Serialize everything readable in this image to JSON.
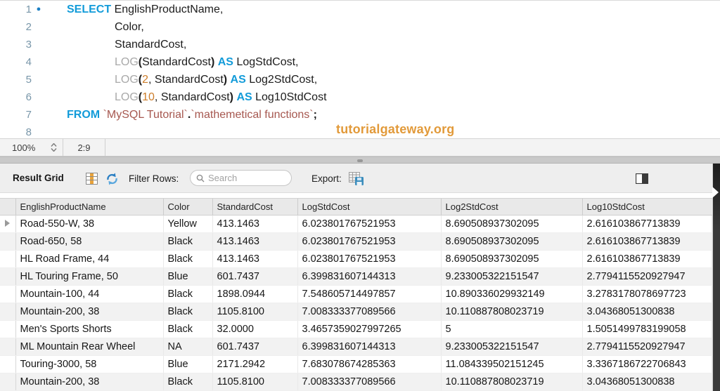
{
  "editor": {
    "watermark": "tutorialgateway.org",
    "lines": [
      {
        "num": "1",
        "marker": true,
        "indent": 0,
        "tokens": [
          {
            "t": "kw",
            "v": "SELECT"
          },
          {
            "t": "pl",
            "v": " EnglishProductName,"
          }
        ]
      },
      {
        "num": "2",
        "marker": false,
        "indent": 1,
        "tokens": [
          {
            "t": "pl",
            "v": "Color,"
          }
        ]
      },
      {
        "num": "3",
        "marker": false,
        "indent": 1,
        "tokens": [
          {
            "t": "pl",
            "v": "StandardCost,"
          }
        ]
      },
      {
        "num": "4",
        "marker": false,
        "indent": 1,
        "tokens": [
          {
            "t": "fn",
            "v": "LOG"
          },
          {
            "t": "pb",
            "v": "("
          },
          {
            "t": "pl",
            "v": "StandardCost"
          },
          {
            "t": "pb",
            "v": ")"
          },
          {
            "t": "pl",
            "v": " "
          },
          {
            "t": "kw",
            "v": "AS"
          },
          {
            "t": "pl",
            "v": " LogStdCost,"
          }
        ]
      },
      {
        "num": "5",
        "marker": false,
        "indent": 1,
        "tokens": [
          {
            "t": "fn",
            "v": "LOG"
          },
          {
            "t": "pb",
            "v": "("
          },
          {
            "t": "num",
            "v": "2"
          },
          {
            "t": "pl",
            "v": ", StandardCost"
          },
          {
            "t": "pb",
            "v": ")"
          },
          {
            "t": "pl",
            "v": " "
          },
          {
            "t": "kw",
            "v": "AS"
          },
          {
            "t": "pl",
            "v": " Log2StdCost,"
          }
        ]
      },
      {
        "num": "6",
        "marker": false,
        "indent": 1,
        "tokens": [
          {
            "t": "fn",
            "v": "LOG"
          },
          {
            "t": "pb",
            "v": "("
          },
          {
            "t": "num",
            "v": "10"
          },
          {
            "t": "pl",
            "v": ", StandardCost"
          },
          {
            "t": "pb",
            "v": ")"
          },
          {
            "t": "pl",
            "v": " "
          },
          {
            "t": "kw",
            "v": "AS"
          },
          {
            "t": "pl",
            "v": " Log10StdCost"
          }
        ]
      },
      {
        "num": "7",
        "marker": false,
        "indent": 0,
        "tokens": [
          {
            "t": "kw",
            "v": "FROM"
          },
          {
            "t": "pl",
            "v": " "
          },
          {
            "t": "str",
            "v": "`MySQL Tutorial`"
          },
          {
            "t": "pb",
            "v": "."
          },
          {
            "t": "str",
            "v": "`mathemetical functions`"
          },
          {
            "t": "pb",
            "v": ";"
          }
        ]
      },
      {
        "num": "8",
        "marker": false,
        "indent": 0,
        "tokens": []
      }
    ]
  },
  "statusbar": {
    "zoom": "100%",
    "position": "2:9"
  },
  "toolbar": {
    "title": "Result Grid",
    "filter_label": "Filter Rows:",
    "search_placeholder": "Search",
    "search_value": "",
    "export_label": "Export:",
    "icons": [
      "column-grid-icon",
      "refresh-icon",
      "search-icon",
      "export-recordset-icon",
      "toggle-side-panel-icon"
    ]
  },
  "grid": {
    "columns": [
      "EnglishProductName",
      "Color",
      "StandardCost",
      "LogStdCost",
      "Log2StdCost",
      "Log10StdCost"
    ],
    "rows": [
      [
        "Road-550-W, 38",
        "Yellow",
        "413.1463",
        "6.023801767521953",
        "8.690508937302095",
        "2.616103867713839"
      ],
      [
        "Road-650, 58",
        "Black",
        "413.1463",
        "6.023801767521953",
        "8.690508937302095",
        "2.616103867713839"
      ],
      [
        "HL Road Frame, 44",
        "Black",
        "413.1463",
        "6.023801767521953",
        "8.690508937302095",
        "2.616103867713839"
      ],
      [
        "HL Touring Frame, 50",
        "Blue",
        "601.7437",
        "6.399831607144313",
        "9.233005322151547",
        "2.7794115520927947"
      ],
      [
        "Mountain-100, 44",
        "Black",
        "1898.0944",
        "7.548605714497857",
        "10.890336029932149",
        "3.2783178078697723"
      ],
      [
        "Mountain-200, 38",
        "Black",
        "1105.8100",
        "7.008333377089566",
        "10.110887808023719",
        "3.04368051300838"
      ],
      [
        "Men's Sports Shorts",
        "Black",
        "32.0000",
        "3.4657359027997265",
        "5",
        "1.5051499783199058"
      ],
      [
        "ML Mountain Rear Wheel",
        "NA",
        "601.7437",
        "6.399831607144313",
        "9.233005322151547",
        "2.7794115520927947"
      ],
      [
        "Touring-3000, 58",
        "Blue",
        "2171.2942",
        "7.683078674285363",
        "11.084339502151245",
        "3.3367186722706843"
      ],
      [
        "Mountain-200, 38",
        "Black",
        "1105.8100",
        "7.008333377089566",
        "10.110887808023719",
        "3.04368051300838"
      ]
    ],
    "active_row_index": 0
  },
  "colors": {
    "keyword_blue": "#129bd9",
    "function_gray": "#a9a9a9",
    "number_orange": "#cd7d2a",
    "string_maroon": "#a6574f",
    "line_number_blue": "#7896a9",
    "watermark_orange": "#e29a3a",
    "grid_icon_orange": "#e8a33b",
    "refresh_blue": "#2b7fc3",
    "floppy_blue": "#3c8dbc"
  }
}
